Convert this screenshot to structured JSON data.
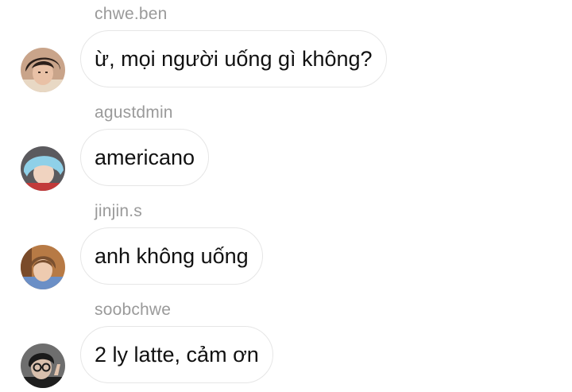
{
  "messages": [
    {
      "username": "chwe.ben",
      "text": "ừ, mọi người uống gì không?",
      "avatar_icon": "user-avatar-icon"
    },
    {
      "username": "agustdmin",
      "text": "americano",
      "avatar_icon": "user-avatar-icon"
    },
    {
      "username": "jinjin.s",
      "text": "anh không uống",
      "avatar_icon": "user-avatar-icon"
    },
    {
      "username": "soobchwe",
      "text": "2 ly latte, cảm ơn",
      "avatar_icon": "user-avatar-icon"
    }
  ],
  "colors": {
    "background": "#ffffff",
    "username": "#9a9a9a",
    "bubble_border": "#e6e6e6",
    "text": "#111111"
  }
}
